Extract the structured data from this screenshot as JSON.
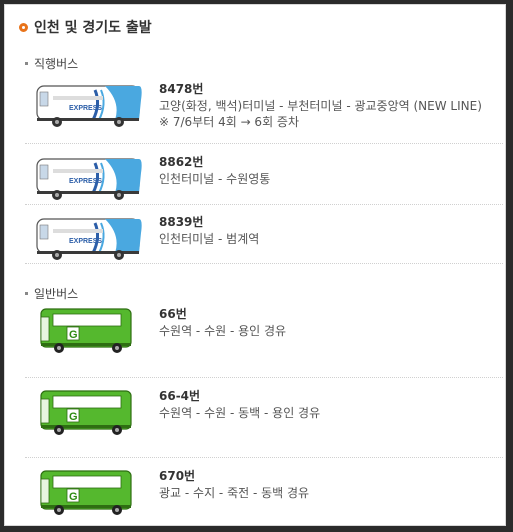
{
  "section": {
    "title": "인천 및 경기도 출발",
    "icon": "orange-circle-bullet-icon"
  },
  "categories": {
    "express": "직행버스",
    "general": "일반버스"
  },
  "colors": {
    "accent": "#e8731a",
    "express_bus": "#4aa8e0",
    "general_bus": "#55b82e"
  },
  "routes": [
    {
      "number": "8478번",
      "line1": "고양(화정, 백석)터미널 - 부천터미널 - 광교중앙역 (NEW LINE)",
      "line2": "※ 7/6부터 4회 → 6회 증차",
      "bus_type": "express",
      "bus_label": "EXPRESS"
    },
    {
      "number": "8862번",
      "line1": "인천터미널 - 수원영통",
      "bus_type": "express",
      "bus_label": "EXPRESS"
    },
    {
      "number": "8839번",
      "line1": "인천터미널 - 범계역",
      "bus_type": "express",
      "bus_label": "EXPRESS"
    },
    {
      "number": "66번",
      "line1": "수원역 - 수원 - 용인 경유",
      "bus_type": "general",
      "bus_label": "G"
    },
    {
      "number": "66-4번",
      "line1": "수원역 - 수원 - 동백 - 용인 경유",
      "bus_type": "general",
      "bus_label": "G"
    },
    {
      "number": "670번",
      "line1": "광교 - 수지 - 죽전 - 동백 경유",
      "bus_type": "general",
      "bus_label": "G"
    }
  ]
}
